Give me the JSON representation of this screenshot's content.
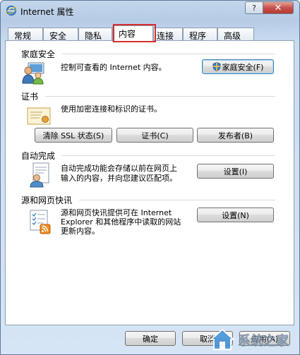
{
  "window": {
    "title": "Internet 属性",
    "help_glyph": "?",
    "close_glyph": "✕"
  },
  "tabs": [
    {
      "label": "常规"
    },
    {
      "label": "安全"
    },
    {
      "label": "隐私"
    },
    {
      "label": "内容",
      "active": true
    },
    {
      "label": "连接"
    },
    {
      "label": "程序"
    },
    {
      "label": "高级"
    }
  ],
  "sections": {
    "family_safety": {
      "title": "家庭安全",
      "description": "控制可查看的 Internet 内容。",
      "button": "家庭安全(F)"
    },
    "certificates": {
      "title": "证书",
      "description": "使用加密连接和标识的证书。",
      "buttons": [
        "清除 SSL 状态(S)",
        "证书(C)",
        "发布者(B)"
      ]
    },
    "autocomplete": {
      "title": "自动完成",
      "description_line1": "自动完成功能会存储以前在网页上",
      "description_line2": "输入的内容，并向您建议匹配项。",
      "button": "设置(I)"
    },
    "feeds": {
      "title": "源和网页快讯",
      "description_line1": "源和网页快讯提供可在 Internet",
      "description_line2": "Explorer 和其他程序中读取的网站",
      "description_line3": "更新内容。",
      "button": "设置(N)"
    }
  },
  "footer": {
    "ok": "确定",
    "cancel": "取消",
    "apply": "应用(A)"
  },
  "watermark": {
    "text": "系统之家"
  },
  "colors": {
    "highlight_box": "#d62d2d",
    "title_bar": "#b6cbe5"
  }
}
